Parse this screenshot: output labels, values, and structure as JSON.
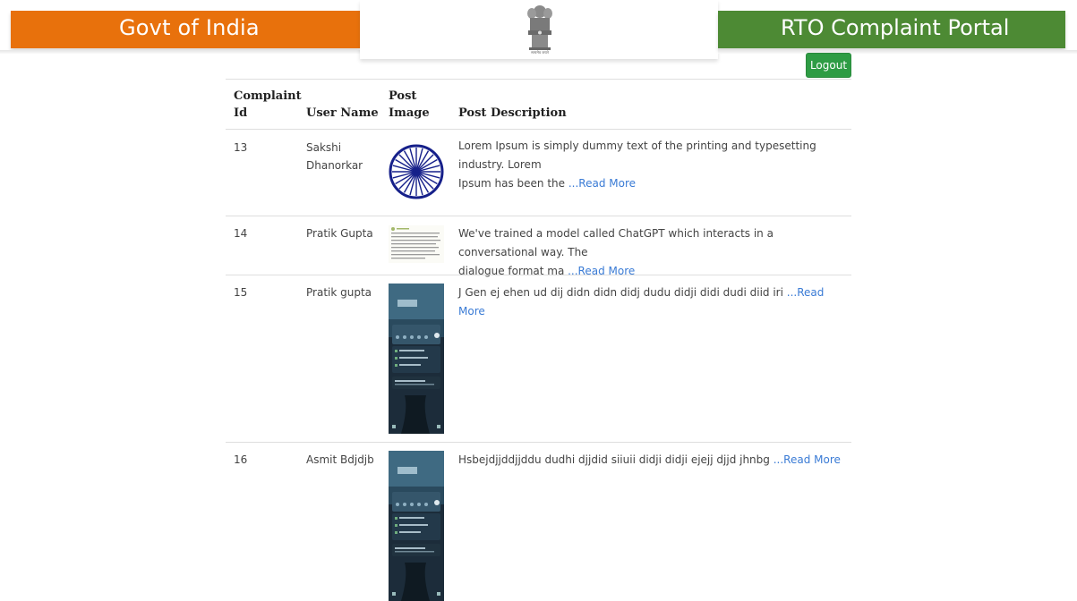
{
  "header": {
    "left_title": "Govt of India",
    "right_title": "RTO Complaint Portal",
    "emblem_motto": "सत्यमेव जयते",
    "colors": {
      "saffron": "#e8710c",
      "green": "#4d8a34"
    }
  },
  "logout_label": "Logout",
  "table": {
    "columns": {
      "id": [
        "Complaint",
        "Id"
      ],
      "user": "User Name",
      "image": [
        "Post",
        "Image"
      ],
      "desc": "Post Description"
    },
    "rows": [
      {
        "id": "13",
        "user": [
          "Sakshi",
          "Dhanorkar"
        ],
        "image_kind": "ashoka-chakra",
        "desc": [
          "Lorem Ipsum is simply dummy text of the printing and typesetting industry. Lorem",
          "Ipsum has been the "
        ],
        "read_more": "...Read More"
      },
      {
        "id": "14",
        "user": [
          "Pratik Gupta"
        ],
        "image_kind": "text-screenshot",
        "desc": [
          "We've trained a model called ChatGPT which interacts in a conversational way. The",
          "dialogue format ma "
        ],
        "read_more": "...Read More"
      },
      {
        "id": "15",
        "user": [
          "Pratik gupta"
        ],
        "image_kind": "phone-screenshot",
        "desc": [
          "J Gen ej ehen ud dij didn didn didj dudu didji didi dudi diid iri "
        ],
        "read_more": "...Read More"
      },
      {
        "id": "16",
        "user": [
          "Asmit Bdjdjb"
        ],
        "image_kind": "phone-screenshot",
        "desc": [
          "Hsbejdjjddjjddu dudhi djjdid siiuii didji didji ejejj djjd jhnbg "
        ],
        "read_more": "...Read More"
      }
    ]
  }
}
